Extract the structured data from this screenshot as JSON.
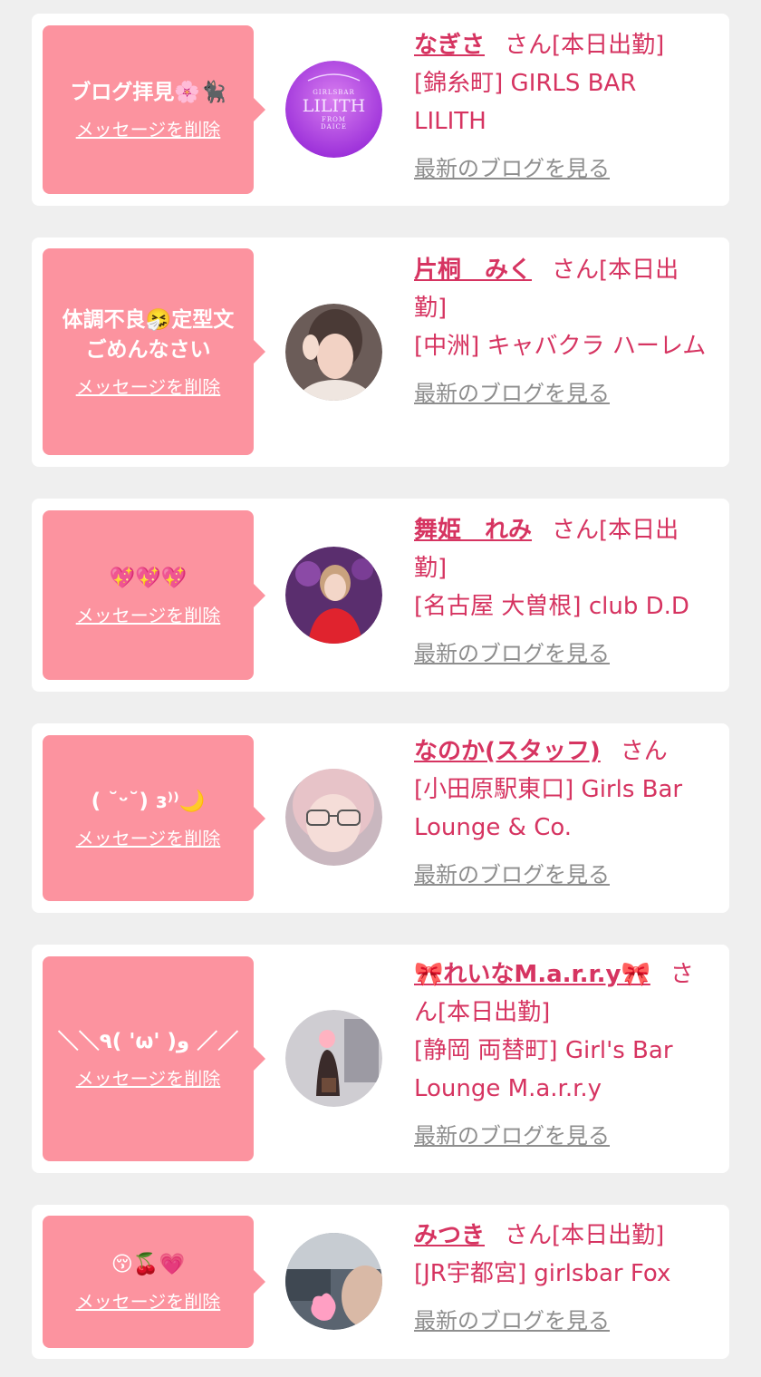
{
  "delete_label": "メッセージを削除",
  "blog_label": "最新のブログを見る",
  "colors": {
    "bubble": "#fc939f",
    "accent": "#d63461",
    "link_gray": "#8e8e8e",
    "background": "#efefef"
  },
  "cards": [
    {
      "message": "ブログ拝見🌸🐈‍⬛",
      "avatar_text": {
        "top": "GIRLSBAR",
        "main": "LILITH",
        "bottom": "FROM DAICE"
      },
      "name": "なぎさ",
      "san": "さん",
      "status": "[本日出勤]",
      "store": "[錦糸町] GIRLS BAR LILITH"
    },
    {
      "message": "体調不良🤧定型文\nごめんなさい",
      "name": "片桐　みく",
      "san": "さん",
      "status": "[本日出勤]",
      "store": "[中洲] キャバクラ ハーレム"
    },
    {
      "message": "💖💖💖",
      "name": "舞姫　れみ",
      "san": "さん",
      "status": "[本日出勤]",
      "store": "[名古屋 大曽根] club D.D"
    },
    {
      "message": "( ˘ᵕ˘) ɜ⁾⁾🌙",
      "name": "なのか(スタッフ)",
      "san": "さん",
      "status": "",
      "store": "[小田原駅東口] Girls Bar Lounge & Co."
    },
    {
      "message": "＼＼٩( 'ω' )و ／／",
      "name": "🎀れいなM.a.r.r.y🎀",
      "san": "さん",
      "status": "[本日出勤]",
      "store": "[静岡 両替町] Girl's Bar Lounge M.a.r.r.y"
    },
    {
      "message": "😚🍒💗",
      "name": "みつき",
      "san": "さん",
      "status": "[本日出勤]",
      "store": "[JR宇都宮] girlsbar Fox"
    }
  ]
}
